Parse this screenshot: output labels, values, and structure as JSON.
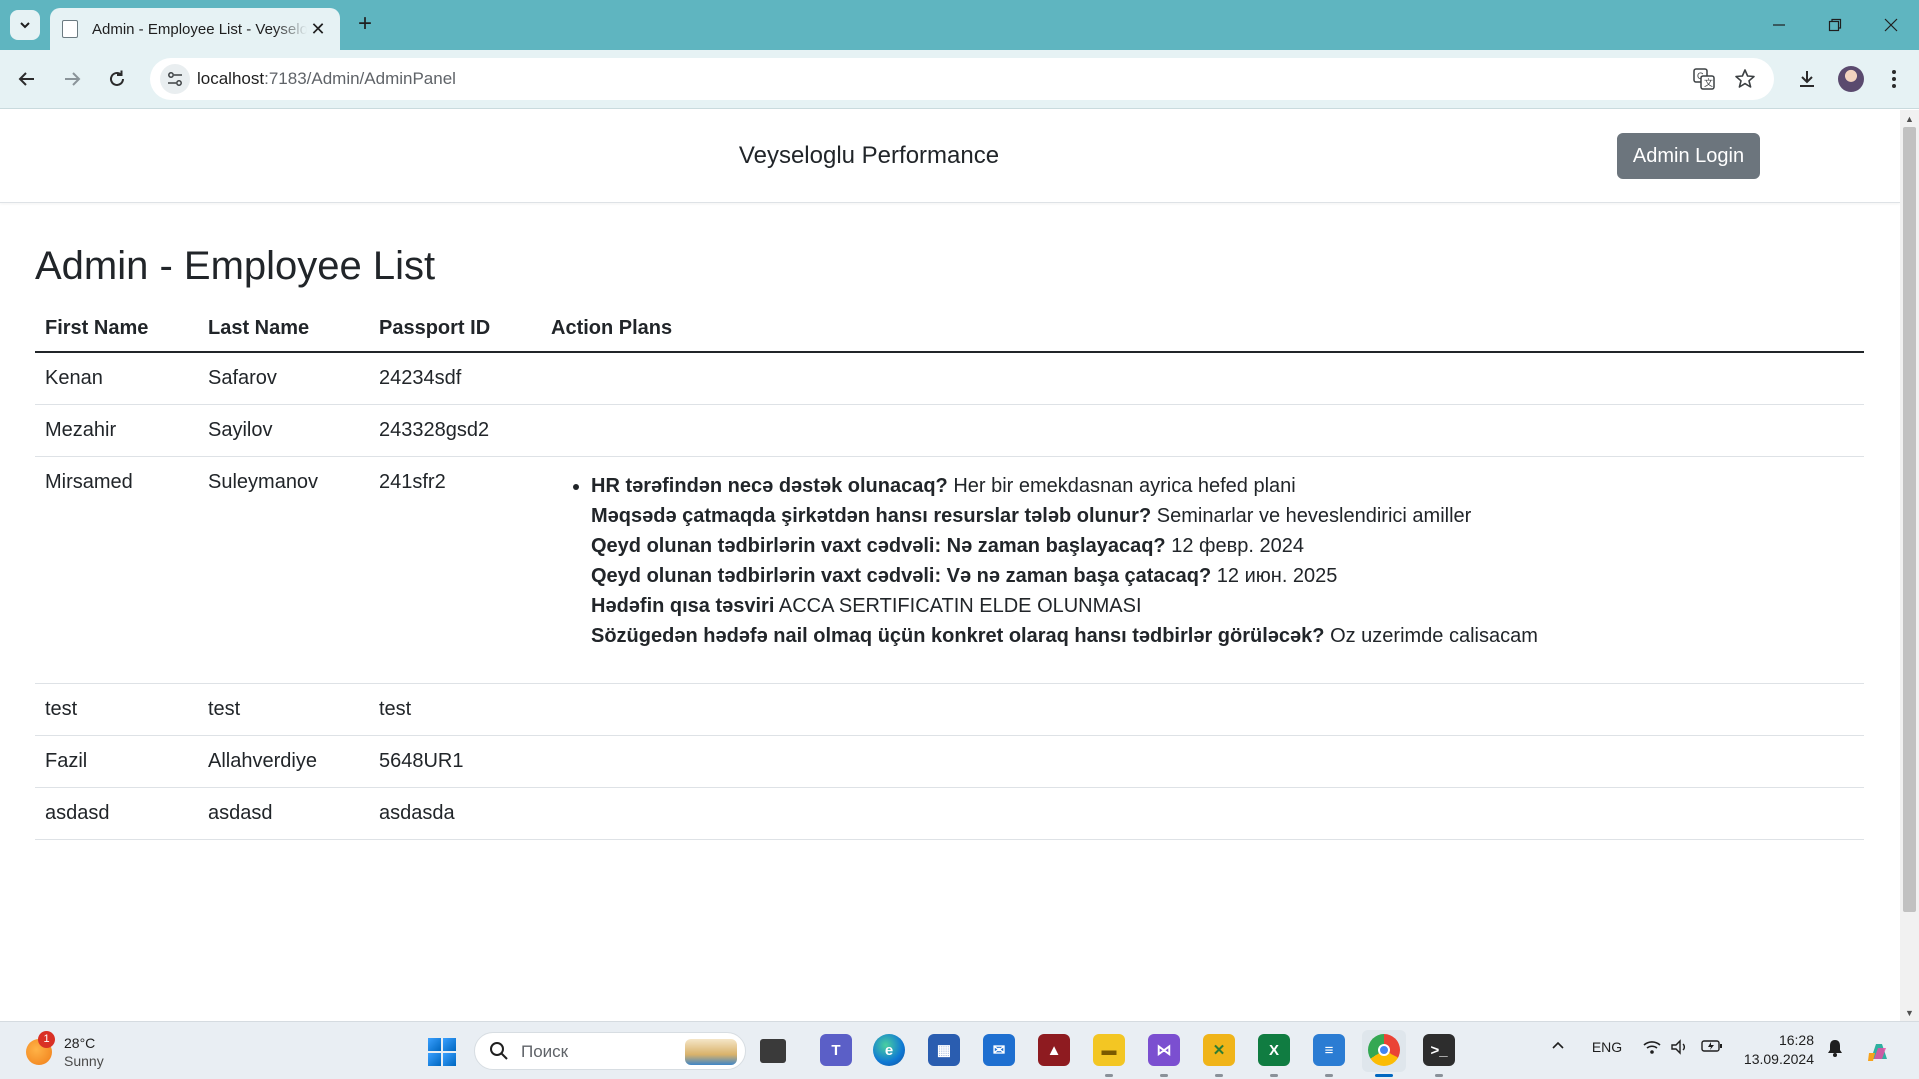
{
  "browser": {
    "tab_title": "Admin - Employee List - Veyseloglu Performance",
    "new_tab_symbol": "+",
    "url_host": "localhost",
    "url_path": ":7183/Admin/AdminPanel"
  },
  "site": {
    "brand": "Veyseloglu Performance",
    "admin_login_label": "Admin Login"
  },
  "page": {
    "title": "Admin - Employee List",
    "columns": [
      "First Name",
      "Last Name",
      "Passport ID",
      "Action Plans"
    ],
    "employees": [
      {
        "first_name": "Kenan",
        "last_name": "Safarov",
        "passport_id": "24234sdf"
      },
      {
        "first_name": "Mezahir",
        "last_name": "Sayilov",
        "passport_id": "243328gsd2"
      },
      {
        "first_name": "Mirsamed",
        "last_name": "Suleymanov",
        "passport_id": "241sfr2",
        "action_plan": [
          {
            "q": "HR tərəfindən necə dəstək olunacaq?",
            "a": "Her bir emekdasnan ayrica hefed plani"
          },
          {
            "q": "Məqsədə çatmaqda şirkətdən hansı resurslar tələb olunur?",
            "a": "Seminarlar ve heveslendirici amiller"
          },
          {
            "q": "Qeyd olunan tədbirlərin vaxt cədvəli: Nə zaman başlayacaq?",
            "a": "12 февр. 2024"
          },
          {
            "q": "Qeyd olunan tədbirlərin vaxt cədvəli: Və nə zaman başa çatacaq?",
            "a": "12 июн. 2025"
          },
          {
            "q": "Hədəfin qısa təsviri",
            "a": "ACCA SERTIFICATIN ELDE OLUNMASI"
          },
          {
            "q": "Sözügedən hədəfə nail olmaq üçün konkret olaraq hansı tədbirlər görüləcək?",
            "a": "Oz uzerimde calisacam"
          }
        ]
      },
      {
        "first_name": "test",
        "last_name": "test",
        "passport_id": "test"
      },
      {
        "first_name": "Fazil",
        "last_name": "Allahverdiye",
        "passport_id": "5648UR1"
      },
      {
        "first_name": "asdasd",
        "last_name": "asdasd",
        "passport_id": "asdasda"
      }
    ]
  },
  "taskbar": {
    "weather_temp": "28°C",
    "weather_cond": "Sunny",
    "weather_badge": "1",
    "search_placeholder": "Поиск",
    "language": "ENG",
    "time": "16:28",
    "date": "13.09.2024"
  },
  "colors": {
    "tab_strip": "#5fb5c0",
    "toolbar": "#e6f2f4",
    "admin_button": "#6c757d"
  }
}
